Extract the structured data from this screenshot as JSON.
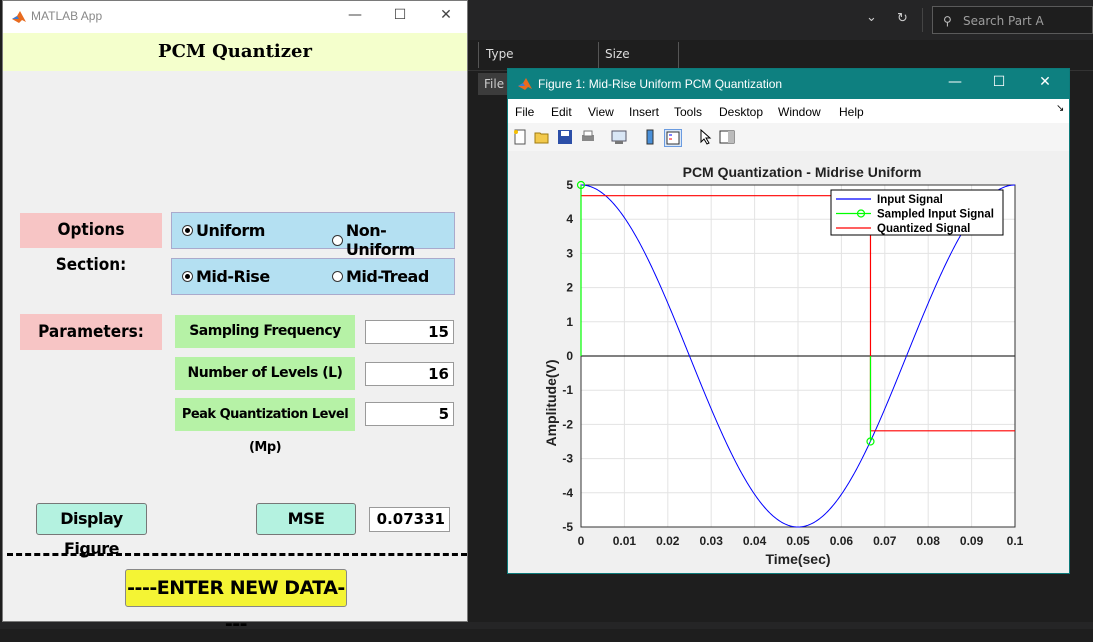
{
  "background": {
    "search_placeholder": "Search Part A",
    "columns": [
      "Type",
      "Size"
    ],
    "row_label": "File"
  },
  "app": {
    "window_title": "MATLAB App",
    "header": "PCM Quantizer",
    "options_label": "Options Section:",
    "radio_uniform": "Uniform",
    "radio_nonuniform": "Non-Uniform",
    "radio_midrise": "Mid-Rise",
    "radio_midtread": "Mid-Tread",
    "selected_type": "Uniform",
    "selected_mode": "Mid-Rise",
    "parameters_label": "Parameters:",
    "fs_label": "Sampling Frequency (fs)",
    "fs_value": "15",
    "levels_label": "Number of Levels (L)",
    "levels_value": "16",
    "mp_label": "Peak Quantization Level (Mp)",
    "mp_value": "5",
    "display_button": "Display Figure",
    "mse_label": "MSE",
    "mse_value": "0.07331",
    "new_data_button": "----ENTER NEW DATA----"
  },
  "figure": {
    "window_title": "Figure 1: Mid-Rise Uniform PCM Quantization",
    "menu": [
      "File",
      "Edit",
      "View",
      "Insert",
      "Tools",
      "Desktop",
      "Window",
      "Help"
    ]
  },
  "chart_data": {
    "type": "line",
    "title": "PCM Quantization - Midrise Uniform",
    "xlabel": "Time(sec)",
    "ylabel": "Amplitude(V)",
    "xlim": [
      0,
      0.1
    ],
    "ylim": [
      -5,
      5
    ],
    "xticks": [
      "0",
      "0.01",
      "0.02",
      "0.03",
      "0.04",
      "0.05",
      "0.06",
      "0.07",
      "0.08",
      "0.09",
      "0.1"
    ],
    "yticks": [
      "5",
      "4",
      "3",
      "2",
      "1",
      "0",
      "-1",
      "-2",
      "-3",
      "-4",
      "-5"
    ],
    "grid": true,
    "legend_position": "top-right",
    "series": [
      {
        "name": "Input Signal",
        "color": "#0000ff",
        "function": "5*cos(2*pi*10*t)"
      },
      {
        "name": "Sampled Input Signal",
        "color": "#00ff00",
        "x": [
          0,
          0.0667
        ],
        "y": [
          5,
          -2.5
        ]
      },
      {
        "name": "Quantized Signal",
        "color": "#ff0000",
        "x": [
          0,
          0.0667,
          0.0667,
          0.1
        ],
        "y": [
          4.6875,
          4.6875,
          -2.1875,
          -2.1875
        ]
      }
    ]
  }
}
